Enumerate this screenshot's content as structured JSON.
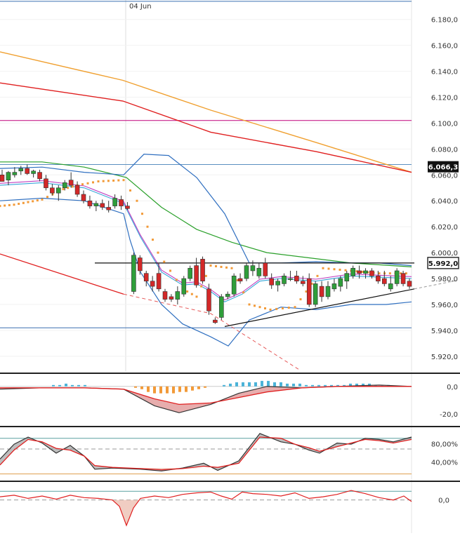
{
  "chart_data": [
    {
      "type": "candlestick",
      "date_label": "04 Jun",
      "y_ticks": [
        "6.180,0",
        "6.160,0",
        "6.140,0",
        "6.120,0",
        "6.100,0",
        "6.080,0",
        "6.060,0",
        "6.040,0",
        "6.020,0",
        "6.000,0",
        "5.980,0",
        "5.960,0",
        "5.940,0",
        "5.920,0"
      ],
      "y_tick_values": [
        6180,
        6160,
        6140,
        6120,
        6100,
        6080,
        6060,
        6040,
        6020,
        6000,
        5980,
        5960,
        5940,
        5920
      ],
      "ylim": [
        5908,
        6195
      ],
      "badges": [
        {
          "label": "6.066,3",
          "value": 6066.3
        },
        {
          "label": "5.992,0",
          "value": 5992.0
        }
      ],
      "hlines": [
        {
          "value": 6194,
          "color": "#3a6fb0"
        },
        {
          "value": 6102,
          "color": "#c0007a"
        },
        {
          "value": 6068,
          "color": "#5a8fc0"
        },
        {
          "value": 5942,
          "color": "#3a6fb0"
        }
      ],
      "candles": [
        [
          6060,
          6064,
          6055,
          6055
        ],
        [
          6056,
          6063,
          6052,
          6062
        ],
        [
          6060,
          6066,
          6058,
          6062
        ],
        [
          6063,
          6067,
          6060,
          6065
        ],
        [
          6065,
          6068,
          6060,
          6061
        ],
        [
          6061,
          6064,
          6058,
          6063
        ],
        [
          6062,
          6064,
          6055,
          6057
        ],
        [
          6057,
          6060,
          6048,
          6050
        ],
        [
          6050,
          6053,
          6044,
          6046
        ],
        [
          6046,
          6052,
          6040,
          6050
        ],
        [
          6050,
          6056,
          6048,
          6054
        ],
        [
          6056,
          6062,
          6050,
          6052
        ],
        [
          6052,
          6055,
          6043,
          6045
        ],
        [
          6045,
          6048,
          6038,
          6040
        ],
        [
          6040,
          6044,
          6034,
          6036
        ],
        [
          6036,
          6040,
          6032,
          6038
        ],
        [
          6038,
          6041,
          6033,
          6035
        ],
        [
          6035,
          6040,
          6031,
          6033
        ],
        [
          6036,
          6045,
          6034,
          6042
        ],
        [
          6041,
          6044,
          6033,
          6036
        ],
        [
          6036,
          6039,
          6033,
          6034
        ],
        [
          5970,
          6000,
          5968,
          5998
        ],
        [
          5996,
          5998,
          5983,
          5986
        ],
        [
          5984,
          5986,
          5974,
          5978
        ],
        [
          5978,
          5982,
          5970,
          5974
        ],
        [
          5984,
          5992,
          5970,
          5972
        ],
        [
          5970,
          5972,
          5962,
          5964
        ],
        [
          5966,
          5968,
          5962,
          5964
        ],
        [
          5964,
          5974,
          5960,
          5970
        ],
        [
          5968,
          5982,
          5966,
          5980
        ],
        [
          5980,
          5990,
          5978,
          5988
        ],
        [
          5990,
          5996,
          5973,
          5975
        ],
        [
          5995,
          5997,
          5976,
          5978
        ],
        [
          5972,
          5976,
          5952,
          5955
        ],
        [
          5948,
          5950,
          5945,
          5946
        ],
        [
          5950,
          5968,
          5948,
          5966
        ],
        [
          5966,
          5970,
          5964,
          5968
        ],
        [
          5968,
          5984,
          5966,
          5982
        ],
        [
          5980,
          5984,
          5976,
          5978
        ],
        [
          5980,
          5992,
          5978,
          5990
        ],
        [
          5986,
          5994,
          5982,
          5990
        ],
        [
          5982,
          5992,
          5980,
          5988
        ],
        [
          5992,
          5996,
          5980,
          5982
        ],
        [
          5980,
          5984,
          5972,
          5975
        ],
        [
          5975,
          5980,
          5970,
          5978
        ],
        [
          5976,
          5984,
          5974,
          5982
        ],
        [
          5980,
          5986,
          5978,
          5980
        ],
        [
          5982,
          5986,
          5976,
          5978
        ],
        [
          5978,
          5982,
          5974,
          5976
        ],
        [
          5980,
          5984,
          5958,
          5960
        ],
        [
          5960,
          5978,
          5958,
          5976
        ],
        [
          5974,
          5978,
          5962,
          5966
        ],
        [
          5966,
          5978,
          5964,
          5974
        ],
        [
          5972,
          5980,
          5970,
          5976
        ],
        [
          5974,
          5982,
          5970,
          5980
        ],
        [
          5978,
          5986,
          5972,
          5984
        ],
        [
          5982,
          5990,
          5980,
          5988
        ],
        [
          5986,
          5990,
          5980,
          5984
        ],
        [
          5984,
          5988,
          5980,
          5986
        ],
        [
          5986,
          5988,
          5980,
          5982
        ],
        [
          5982,
          5986,
          5976,
          5978
        ],
        [
          5980,
          5986,
          5974,
          5976
        ],
        [
          5972,
          5982,
          5970,
          5976
        ],
        [
          5976,
          5988,
          5974,
          5986
        ],
        [
          5984,
          5986,
          5974,
          5976
        ],
        [
          5978,
          5980,
          5972,
          5974
        ]
      ],
      "ma_orange_long": [
        [
          0,
          6155
        ],
        [
          175,
          6133
        ],
        [
          300,
          6110
        ],
        [
          450,
          6085
        ],
        [
          586,
          6062
        ]
      ],
      "ma_red_long": [
        [
          0,
          6131
        ],
        [
          175,
          6117
        ],
        [
          300,
          6093
        ],
        [
          450,
          6078
        ],
        [
          586,
          6062
        ]
      ],
      "ma_green": [
        [
          0,
          6070
        ],
        [
          60,
          6070
        ],
        [
          120,
          6066
        ],
        [
          180,
          6058
        ],
        [
          230,
          6035
        ],
        [
          280,
          6018
        ],
        [
          330,
          6008
        ],
        [
          380,
          6000
        ],
        [
          440,
          5996
        ],
        [
          500,
          5992
        ],
        [
          586,
          5989
        ]
      ],
      "bb_upper": [
        [
          0,
          6065
        ],
        [
          60,
          6066
        ],
        [
          120,
          6062
        ],
        [
          176,
          6060
        ],
        [
          205,
          6076
        ],
        [
          240,
          6075
        ],
        [
          280,
          6058
        ],
        [
          320,
          6030
        ],
        [
          355,
          5992
        ],
        [
          400,
          5992
        ],
        [
          450,
          5993
        ],
        [
          500,
          5992
        ],
        [
          540,
          5992
        ],
        [
          586,
          5990
        ]
      ],
      "bb_mid": [
        [
          0,
          6052
        ],
        [
          60,
          6054
        ],
        [
          120,
          6050
        ],
        [
          176,
          6038
        ],
        [
          200,
          6012
        ],
        [
          230,
          5985
        ],
        [
          260,
          5975
        ],
        [
          280,
          5976
        ],
        [
          300,
          5970
        ],
        [
          320,
          5962
        ],
        [
          345,
          5968
        ],
        [
          370,
          5978
        ],
        [
          400,
          5980
        ],
        [
          450,
          5978
        ],
        [
          500,
          5982
        ],
        [
          586,
          5980
        ]
      ],
      "bb_lower": [
        [
          0,
          6040
        ],
        [
          60,
          6042
        ],
        [
          120,
          6040
        ],
        [
          176,
          6030
        ],
        [
          185,
          6010
        ],
        [
          200,
          5985
        ],
        [
          230,
          5960
        ],
        [
          260,
          5945
        ],
        [
          300,
          5935
        ],
        [
          325,
          5928
        ],
        [
          355,
          5948
        ],
        [
          400,
          5958
        ],
        [
          450,
          5956
        ],
        [
          500,
          5960
        ],
        [
          550,
          5960
        ],
        [
          586,
          5962
        ]
      ],
      "sar_dots": [
        [
          0,
          6036
        ],
        [
          20,
          6037
        ],
        [
          40,
          6039
        ],
        [
          60,
          6041
        ],
        [
          90,
          6049
        ],
        [
          110,
          6052
        ],
        [
          140,
          6055
        ],
        [
          176,
          6056
        ],
        [
          195,
          6040
        ],
        [
          225,
          6000
        ],
        [
          260,
          5972
        ],
        [
          280,
          5966
        ],
        [
          300,
          5990
        ],
        [
          330,
          5988
        ],
        [
          355,
          5960
        ],
        [
          385,
          5956
        ],
        [
          420,
          5958
        ],
        [
          460,
          5988
        ],
        [
          500,
          5986
        ],
        [
          540,
          5984
        ],
        [
          586,
          5984
        ]
      ],
      "trend_red": [
        [
          0,
          5999
        ],
        [
          176,
          5968
        ],
        [
          300,
          5953
        ],
        [
          425,
          5910
        ]
      ],
      "trend_black": [
        [
          320,
          5943
        ],
        [
          590,
          5972
        ]
      ],
      "resistance_black": [
        [
          135,
          5992
        ],
        [
          590,
          5992
        ]
      ]
    },
    {
      "type": "histogram",
      "y_ticks": [
        "0,0",
        "-20,0"
      ],
      "ylim": [
        -28,
        8
      ],
      "histogram": [
        0,
        0,
        0,
        0,
        0,
        0,
        0,
        0,
        1,
        1,
        2,
        1,
        1,
        1,
        0,
        0,
        0,
        0,
        0,
        0,
        0,
        -1,
        -2,
        -4,
        -5,
        -5,
        -5,
        -5,
        -4,
        -4,
        -3,
        -2,
        -1,
        0,
        0,
        1,
        2,
        3,
        3,
        3,
        3,
        4,
        4,
        3,
        3,
        2,
        2,
        2,
        1,
        1,
        1,
        1,
        1,
        1,
        1,
        2,
        2,
        2,
        2,
        1,
        1,
        1,
        0,
        0,
        0,
        0,
        0
      ],
      "macd": [
        [
          0,
          -2
        ],
        [
          60,
          -1
        ],
        [
          120,
          -1
        ],
        [
          176,
          -2
        ],
        [
          220,
          -14
        ],
        [
          255,
          -19
        ],
        [
          300,
          -13
        ],
        [
          340,
          -5
        ],
        [
          380,
          0
        ],
        [
          430,
          -1
        ],
        [
          480,
          0
        ],
        [
          540,
          1
        ],
        [
          586,
          0
        ]
      ],
      "signal": [
        [
          0,
          -1
        ],
        [
          60,
          -1
        ],
        [
          120,
          -1
        ],
        [
          176,
          -2
        ],
        [
          220,
          -9
        ],
        [
          255,
          -13
        ],
        [
          300,
          -12
        ],
        [
          340,
          -8
        ],
        [
          380,
          -4
        ],
        [
          430,
          -1
        ],
        [
          480,
          0
        ],
        [
          540,
          0
        ],
        [
          586,
          0
        ]
      ]
    },
    {
      "type": "oscillator",
      "y_ticks": [
        "80,00%",
        "40,00%"
      ],
      "ylim": [
        10,
        95
      ],
      "fast": [
        [
          0,
          45
        ],
        [
          20,
          70
        ],
        [
          40,
          82
        ],
        [
          60,
          72
        ],
        [
          80,
          55
        ],
        [
          100,
          68
        ],
        [
          120,
          50
        ],
        [
          135,
          28
        ],
        [
          160,
          30
        ],
        [
          200,
          28
        ],
        [
          230,
          25
        ],
        [
          260,
          30
        ],
        [
          290,
          38
        ],
        [
          310,
          26
        ],
        [
          340,
          42
        ],
        [
          370,
          88
        ],
        [
          400,
          74
        ],
        [
          420,
          70
        ],
        [
          440,
          60
        ],
        [
          455,
          55
        ],
        [
          480,
          72
        ],
        [
          500,
          70
        ],
        [
          520,
          80
        ],
        [
          540,
          78
        ],
        [
          560,
          74
        ],
        [
          586,
          82
        ]
      ],
      "slow": [
        [
          0,
          35
        ],
        [
          20,
          60
        ],
        [
          40,
          78
        ],
        [
          60,
          74
        ],
        [
          80,
          63
        ],
        [
          100,
          60
        ],
        [
          120,
          50
        ],
        [
          135,
          34
        ],
        [
          160,
          31
        ],
        [
          200,
          29
        ],
        [
          230,
          27
        ],
        [
          260,
          29
        ],
        [
          290,
          33
        ],
        [
          310,
          31
        ],
        [
          340,
          38
        ],
        [
          370,
          82
        ],
        [
          400,
          80
        ],
        [
          420,
          70
        ],
        [
          440,
          64
        ],
        [
          455,
          58
        ],
        [
          480,
          66
        ],
        [
          500,
          72
        ],
        [
          520,
          78
        ],
        [
          540,
          76
        ],
        [
          560,
          72
        ],
        [
          586,
          78
        ]
      ],
      "bands": [
        80,
        40,
        20
      ]
    },
    {
      "type": "line",
      "y_ticks": [
        "0,0"
      ],
      "ylim": [
        -4,
        2
      ],
      "values": [
        [
          0,
          0.4
        ],
        [
          20,
          0.6
        ],
        [
          40,
          0.2
        ],
        [
          60,
          0.5
        ],
        [
          80,
          0.1
        ],
        [
          100,
          0.6
        ],
        [
          120,
          0.3
        ],
        [
          140,
          0.2
        ],
        [
          160,
          0.0
        ],
        [
          170,
          -0.8
        ],
        [
          180,
          -3.2
        ],
        [
          190,
          -1.0
        ],
        [
          200,
          0.2
        ],
        [
          220,
          0.5
        ],
        [
          240,
          0.3
        ],
        [
          260,
          0.7
        ],
        [
          280,
          0.9
        ],
        [
          300,
          1.0
        ],
        [
          315,
          0.5
        ],
        [
          330,
          0.1
        ],
        [
          345,
          1.0
        ],
        [
          360,
          0.8
        ],
        [
          380,
          0.7
        ],
        [
          400,
          0.5
        ],
        [
          420,
          0.9
        ],
        [
          440,
          0.2
        ],
        [
          460,
          0.4
        ],
        [
          480,
          0.7
        ],
        [
          500,
          1.2
        ],
        [
          520,
          0.8
        ],
        [
          540,
          0.3
        ],
        [
          560,
          0.0
        ],
        [
          575,
          0.5
        ],
        [
          586,
          -0.2
        ]
      ]
    }
  ]
}
